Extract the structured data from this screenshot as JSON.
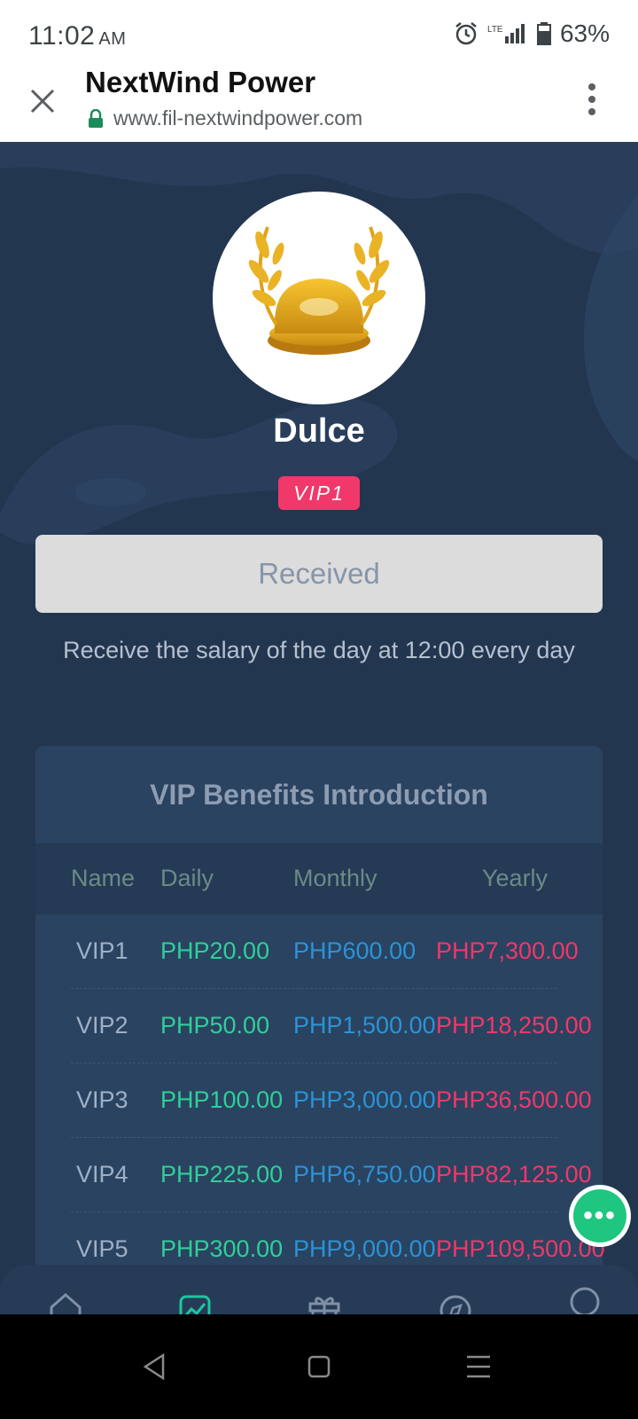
{
  "status_bar": {
    "time": "11:02",
    "ampm": "AM",
    "network": "LTE",
    "battery": "63%",
    "icons": [
      "alarm-icon",
      "signal-icon",
      "battery-icon"
    ]
  },
  "browser": {
    "title": "NextWind Power",
    "url": "www.fil-nextwindpower.com",
    "icons": [
      "close-icon",
      "lock-icon",
      "more-vert-icon"
    ]
  },
  "profile": {
    "name": "Dulce",
    "vip_level": "VIP1",
    "avatar_icon": "laurel-crown-trophy"
  },
  "salary": {
    "button_label": "Received",
    "note": "Receive the salary of the day at 12:00 every day"
  },
  "benefits": {
    "title": "VIP Benefits Introduction",
    "headers": [
      "Name",
      "Daily",
      "Monthly",
      "Yearly"
    ],
    "rows": [
      {
        "name": "VIP1",
        "daily": "PHP20.00",
        "monthly": "PHP600.00",
        "yearly": "PHP7,300.00"
      },
      {
        "name": "VIP2",
        "daily": "PHP50.00",
        "monthly": "PHP1,500.00",
        "yearly": "PHP18,250.00"
      },
      {
        "name": "VIP3",
        "daily": "PHP100.00",
        "monthly": "PHP3,000.00",
        "yearly": "PHP36,500.00"
      },
      {
        "name": "VIP4",
        "daily": "PHP225.00",
        "monthly": "PHP6,750.00",
        "yearly": "PHP82,125.00"
      },
      {
        "name": "VIP5",
        "daily": "PHP300.00",
        "monthly": "PHP9,000.00",
        "yearly": "PHP109,500.00"
      }
    ]
  },
  "chat": {
    "icon": "chat-bubble-icon",
    "glyph": "•••"
  },
  "bottom_nav": {
    "items": [
      "home-icon",
      "chart-icon",
      "gift-icon",
      "compass-icon",
      "profile-icon"
    ],
    "active": "chart-icon"
  },
  "colors": {
    "accent_pink": "#f0386a",
    "daily_green": "#2fcf9a",
    "monthly_blue": "#2b93d6",
    "chat_green": "#1ec680",
    "background": "#233650"
  }
}
